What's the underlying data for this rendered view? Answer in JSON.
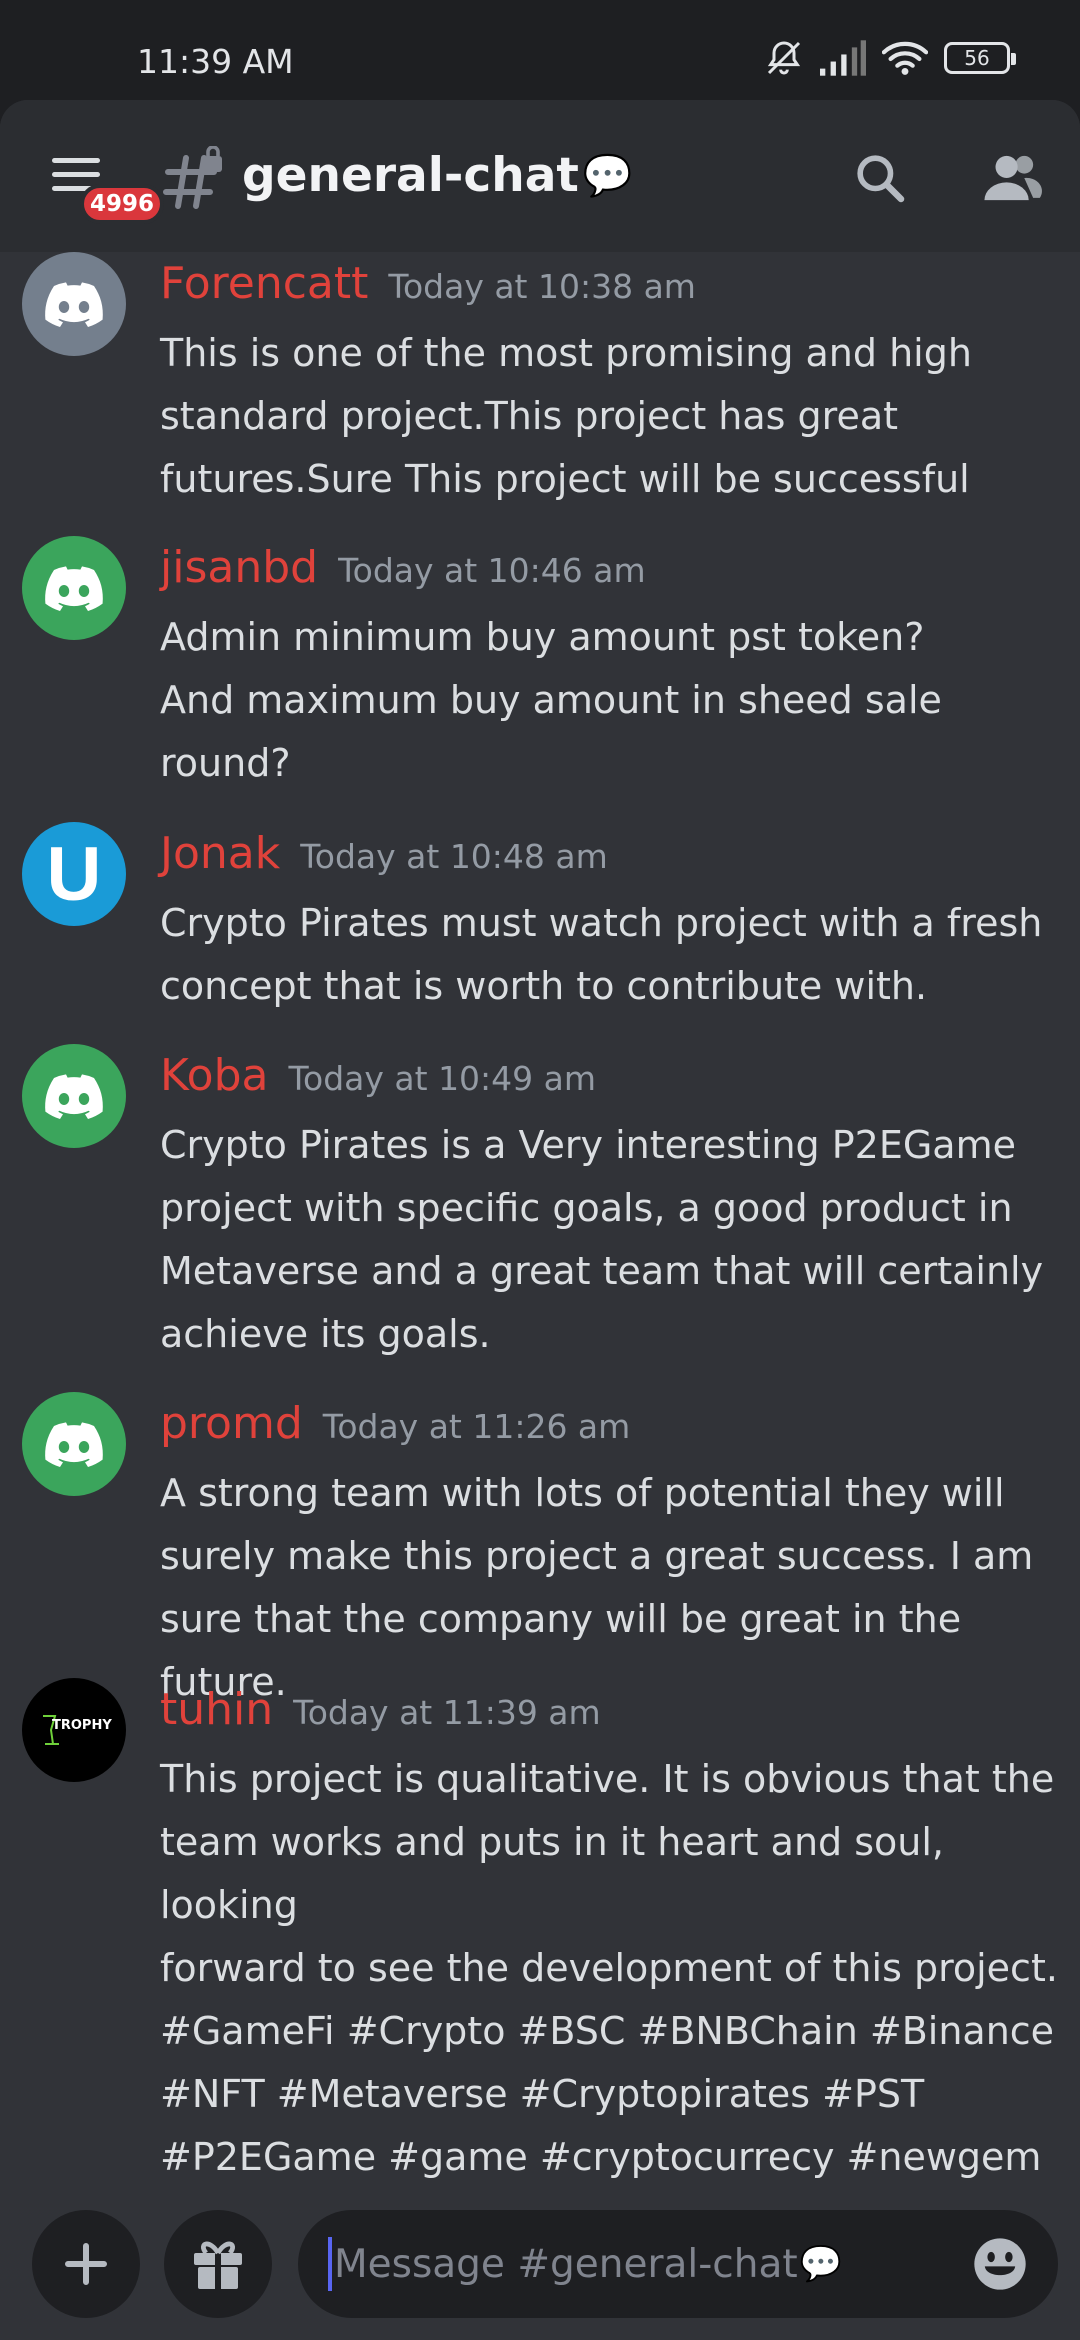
{
  "status_bar": {
    "time": "11:39 AM",
    "battery": "56",
    "icons": [
      "bell-off-icon",
      "signal-icon",
      "wifi-icon",
      "battery-icon"
    ]
  },
  "header": {
    "unread_badge": "4996",
    "channel_name": "general-chat",
    "channel_emoji": "💬",
    "icons": [
      "menu-icon",
      "locked-channel-icon",
      "search-icon",
      "members-icon"
    ]
  },
  "messages": [
    {
      "username": "Forencatt",
      "timestamp": "Today at 10:38 am",
      "avatar": "discord-logo-grey",
      "text": "This is one of the most promising and high\nstandard project.This project has great\nfutures.Sure This project will be successful"
    },
    {
      "username": "jisanbd",
      "timestamp": "Today at 10:46 am",
      "avatar": "discord-logo-green",
      "text": "Admin minimum buy amount pst token?\nAnd maximum buy amount in sheed sale\nround?"
    },
    {
      "username": "Jonak",
      "timestamp": "Today at 10:48 am",
      "avatar_letter": "U",
      "text": "Crypto Pirates must watch project with a fresh\nconcept that is worth to contribute with."
    },
    {
      "username": "Koba",
      "timestamp": "Today at 10:49 am",
      "avatar": "discord-logo-green",
      "text": "Crypto Pirates is a Very interesting P2EGame\nproject with specific goals, a good product in\nMetaverse and a great team that will certainly\nachieve its goals."
    },
    {
      "username": "promd",
      "timestamp": "Today at 11:26 am",
      "avatar": "discord-logo-green",
      "text": "A strong team with lots of potential they will\nsurely make this project a great success. I am\nsure that the company will be great in the future."
    },
    {
      "username": "tuhin",
      "timestamp": "Today at 11:39 am",
      "avatar_text": "TROPHY",
      "text": "This project is qualitative. It is obvious that the\nteam works and puts in it heart and soul, looking\nforward to see the development of this project.\n#GameFi #Crypto #BSC #BNBChain #Binance\n#NFT #Metaverse #Cryptopirates #PST\n#P2EGame #game #cryptocurrecy #newgem"
    }
  ],
  "composer": {
    "placeholder": "Message #general-chat",
    "placeholder_emoji": "💬",
    "icons": [
      "plus-icon",
      "gift-icon",
      "emoji-icon"
    ]
  },
  "colors": {
    "username": "#e0423b",
    "background": "#313338",
    "header": "#2b2d31",
    "discord_grey": "#747f8d",
    "discord_green": "#3ba55c",
    "avatar_blue": "#1a9bd7"
  }
}
